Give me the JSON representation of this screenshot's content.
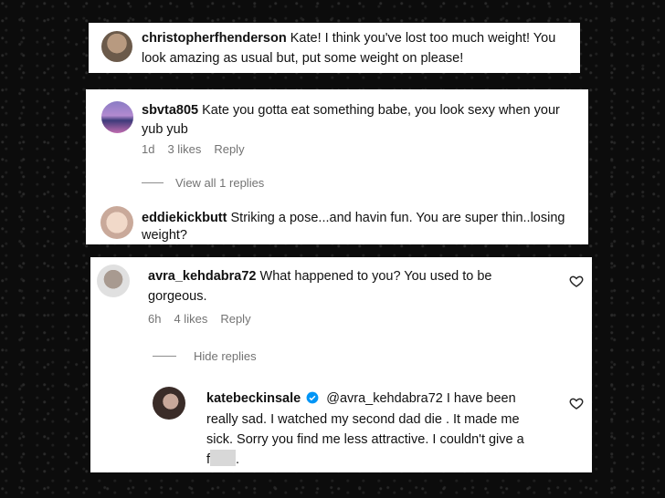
{
  "comments": [
    {
      "username": "christopherfhenderson",
      "text_line1": "Kate! I think you've lost too much weight! You",
      "text_line2": "look amazing as usual but, put some weight on please!"
    },
    {
      "username": "sbvta805",
      "text_line1": "Kate you gotta eat something babe, you look sexy when your",
      "text_line2": "yub yub",
      "time": "1d",
      "likes": "3 likes",
      "reply": "Reply",
      "view_replies": "View all 1 replies"
    },
    {
      "username": "eddiekickbutt",
      "text_line1": "Striking a pose...and havin fun. You are super thin..losing",
      "text_line2": "weight?"
    },
    {
      "username": "avra_kehdabra72",
      "text_line1": "What happened to you? You used to be",
      "text_line2": "gorgeous.",
      "time": "6h",
      "likes": "4 likes",
      "reply": "Reply",
      "hide_replies": "Hide replies"
    }
  ],
  "reply": {
    "username": "katebeckinsale",
    "mention": "@avra_kehdabra72",
    "text_line1_rest": "I have been",
    "text_line2": "really sad. I watched my second dad die . It made me",
    "text_line3": "sick. Sorry you find me less attractive. I couldn't give a",
    "text_line4_start": "f",
    "text_line4_end": "."
  },
  "colors": {
    "verified": "#0095f6",
    "meta_gray": "#737373"
  },
  "icons": [
    "heart-outline-icon",
    "verified-badge-icon"
  ]
}
